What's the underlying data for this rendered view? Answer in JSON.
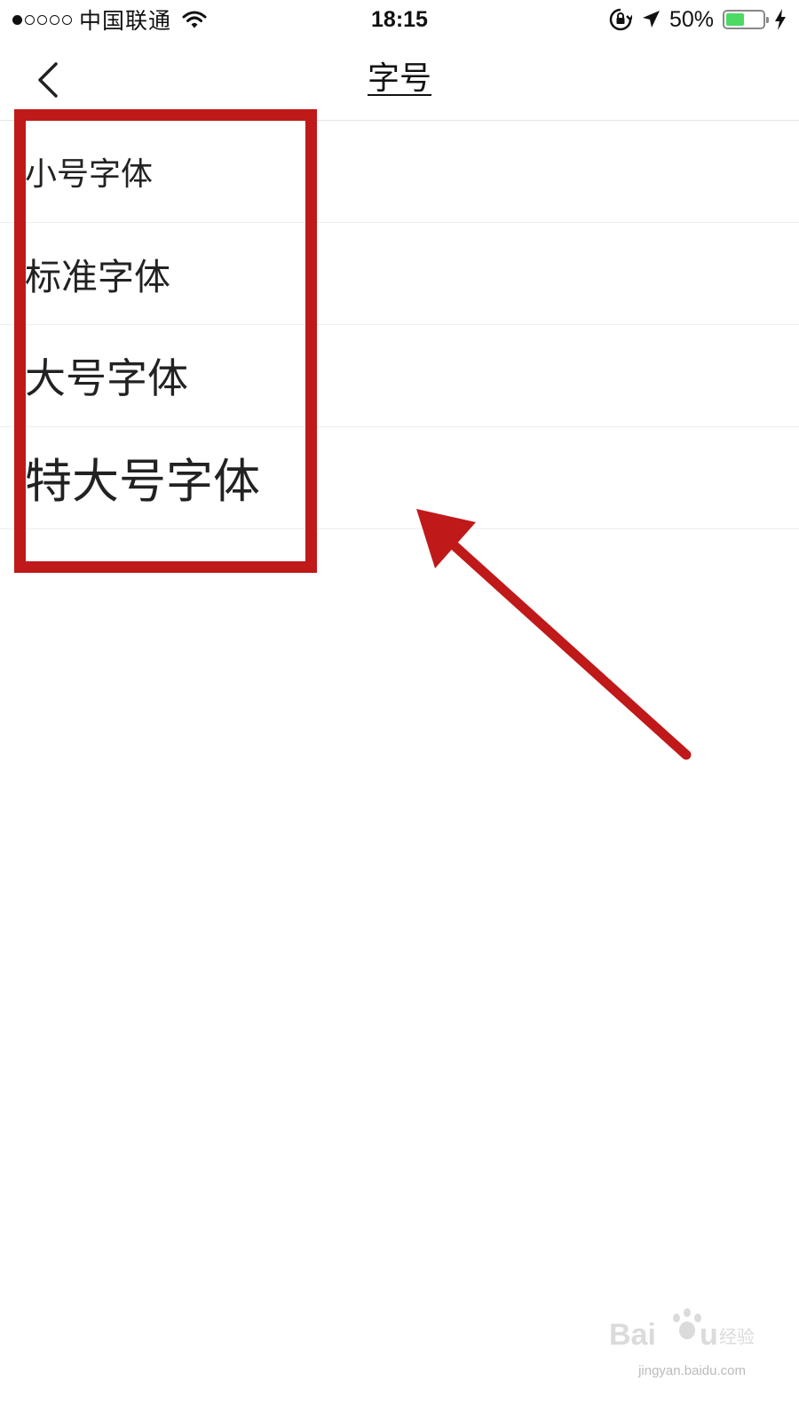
{
  "status_bar": {
    "carrier": "中国联通",
    "time": "18:15",
    "battery_percent_label": "50%",
    "battery_level": 0.5,
    "signal_bars_filled": 1,
    "signal_bars_total": 5
  },
  "nav": {
    "title": "字号"
  },
  "options": [
    {
      "label": "小号字体",
      "size": "small"
    },
    {
      "label": "标准字体",
      "size": "standard"
    },
    {
      "label": "大号字体",
      "size": "large"
    },
    {
      "label": "特大号字体",
      "size": "xlarge"
    }
  ],
  "annotation": {
    "color": "#c0191a"
  },
  "watermark": {
    "text": "Baidu经验",
    "url_text": "jingyan.baidu.com"
  },
  "colors": {
    "battery_green": "#4cd964",
    "separator": "#eeeeee"
  }
}
